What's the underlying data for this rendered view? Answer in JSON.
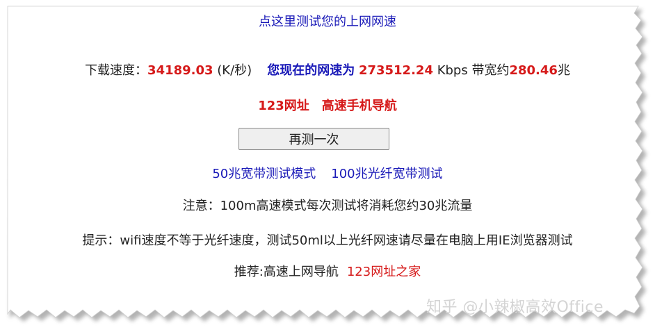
{
  "header_link": "点这里测试您的上网网速",
  "speed": {
    "download_label": "下载速度：",
    "download_value": "34189.03",
    "download_unit": " (K/秒)",
    "current_label": "您现在的网速为",
    "kbps_value": "273512.24",
    "kbps_unit": " Kbps 带宽约",
    "mbps_value": "280.46",
    "mbps_unit": "兆"
  },
  "promo": {
    "site": "123网址",
    "nav": "高速手机导航"
  },
  "retest_button": "再测一次",
  "modes": {
    "mode_50": "50兆宽带测试模式",
    "mode_100": "100兆光纤宽带测试"
  },
  "notice": "注意：100m高速模式每次测试将消耗您约30兆流量",
  "tip": "提示：wifi速度不等于光纤速度，测试50ml以上光纤网速请尽量在电脑上用IE浏览器测试",
  "recommend": {
    "label": "推荐:高速上网导航",
    "link": "123网址之家"
  },
  "watermark": "知乎 @小辣椒高效Office",
  "colors": {
    "link_blue": "#1a1ab8",
    "value_red": "#d61a1a",
    "text": "#222222"
  }
}
